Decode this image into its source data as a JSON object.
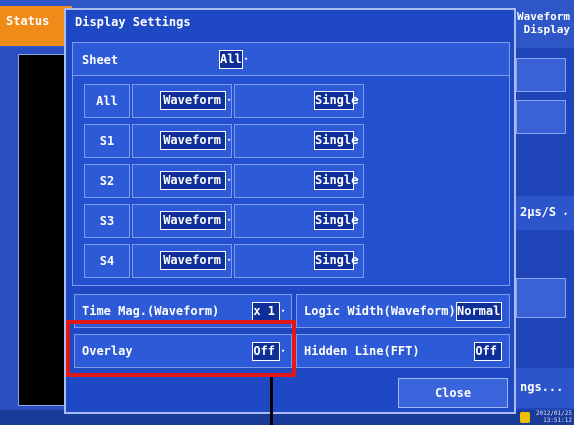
{
  "background": {
    "status_tab": "Status",
    "waveform_tab_line1": "Waveform",
    "waveform_tab_line2": "Display",
    "speed_value": "2µs/S",
    "settings_partial": "ngs...",
    "clock_date": "2012/01/25",
    "clock_time": "13:51:12"
  },
  "dialog": {
    "title": "Display Settings",
    "sheet_label": "Sheet",
    "sheet_value": "All",
    "rows": [
      {
        "name": "All",
        "display": "Waveform",
        "mode": "Single"
      },
      {
        "name": "S1",
        "display": "Waveform",
        "mode": "Single"
      },
      {
        "name": "S2",
        "display": "Waveform",
        "mode": "Single"
      },
      {
        "name": "S3",
        "display": "Waveform",
        "mode": "Single"
      },
      {
        "name": "S4",
        "display": "Waveform",
        "mode": "Single"
      }
    ],
    "time_mag_label": "Time Mag.(Waveform)",
    "time_mag_value": "x 1",
    "logic_width_label": "Logic Width(Waveform)",
    "logic_width_value": "Normal",
    "overlay_label": "Overlay",
    "overlay_value": "Off",
    "hidden_line_label": "Hidden Line(FFT)",
    "hidden_line_value": "Off",
    "close_label": "Close"
  },
  "colors": {
    "dialog_bg": "#1f48c4",
    "highlight": "#e01818",
    "status_tab": "#f08a18"
  }
}
